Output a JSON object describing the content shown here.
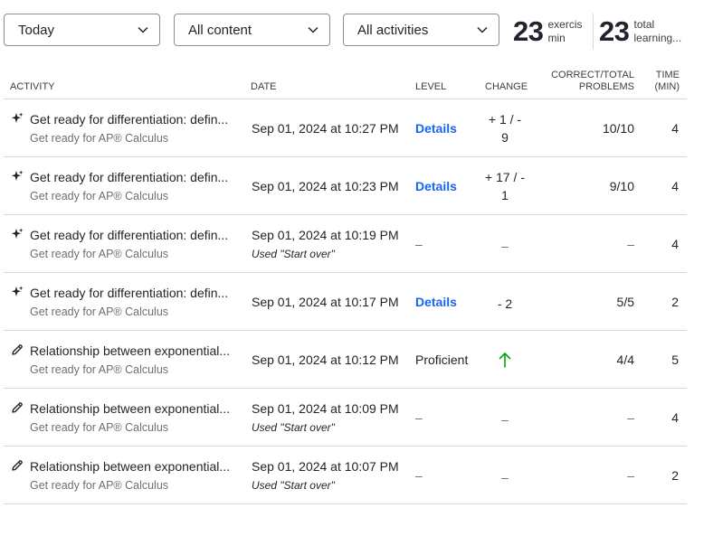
{
  "filters": {
    "time": "Today",
    "content": "All content",
    "activities": "All activities"
  },
  "stats": {
    "exercise_min_value": "23",
    "exercise_min_label_line1": "exercis",
    "exercise_min_label_line2": "min",
    "total_learning_value": "23",
    "total_learning_label_line1": "total",
    "total_learning_label_line2": "learning..."
  },
  "table": {
    "headers": {
      "activity": "ACTIVITY",
      "date": "DATE",
      "level": "LEVEL",
      "change": "CHANGE",
      "correct_line1": "CORRECT/TOTAL",
      "correct_line2": "PROBLEMS",
      "time_line1": "TIME",
      "time_line2": "(MIN)"
    },
    "rows": [
      {
        "icon": "sparkle-icon",
        "title": "Get ready for differentiation: defin...",
        "course": "Get ready for AP® Calculus",
        "date": "Sep 01, 2024 at 10:27 PM",
        "date_note": "",
        "level": "Details",
        "change_line1": "+ 1 / -",
        "change_line2": "9",
        "correct": "10/10",
        "time": "4"
      },
      {
        "icon": "sparkle-icon",
        "title": "Get ready for differentiation: defin...",
        "course": "Get ready for AP® Calculus",
        "date": "Sep 01, 2024 at 10:23 PM",
        "date_note": "",
        "level": "Details",
        "change_line1": "+ 17 / -",
        "change_line2": "1",
        "correct": "9/10",
        "time": "4"
      },
      {
        "icon": "sparkle-icon",
        "title": "Get ready for differentiation: defin...",
        "course": "Get ready for AP® Calculus",
        "date": "Sep 01, 2024 at 10:19 PM",
        "date_note": "Used \"Start over\"",
        "level": "–",
        "change_line1": "–",
        "change_line2": "",
        "correct": "–",
        "time": "4"
      },
      {
        "icon": "sparkle-icon",
        "title": "Get ready for differentiation: defin...",
        "course": "Get ready for AP® Calculus",
        "date": "Sep 01, 2024 at 10:17 PM",
        "date_note": "",
        "level": "Details",
        "change_line1": "- 2",
        "change_line2": "",
        "correct": "5/5",
        "time": "2"
      },
      {
        "icon": "pencil-icon",
        "title": "Relationship between exponential...",
        "course": "Get ready for AP® Calculus",
        "date": "Sep 01, 2024 at 10:12 PM",
        "date_note": "",
        "level": "Proficient",
        "change_line1": "",
        "change_line2": "",
        "change_icon": "arrow-up-icon",
        "correct": "4/4",
        "time": "5"
      },
      {
        "icon": "pencil-icon",
        "title": "Relationship between exponential...",
        "course": "Get ready for AP® Calculus",
        "date": "Sep 01, 2024 at 10:09 PM",
        "date_note": "Used \"Start over\"",
        "level": "–",
        "change_line1": "–",
        "change_line2": "",
        "correct": "–",
        "time": "4"
      },
      {
        "icon": "pencil-icon",
        "title": "Relationship between exponential...",
        "course": "Get ready for AP® Calculus",
        "date": "Sep 01, 2024 at 10:07 PM",
        "date_note": "Used \"Start over\"",
        "level": "–",
        "change_line1": "–",
        "change_line2": "",
        "correct": "–",
        "time": "2"
      }
    ]
  },
  "colors": {
    "link": "#1865f2",
    "up_arrow": "#00a60e",
    "divider": "#d6d8da",
    "muted": "#6b6f75"
  }
}
